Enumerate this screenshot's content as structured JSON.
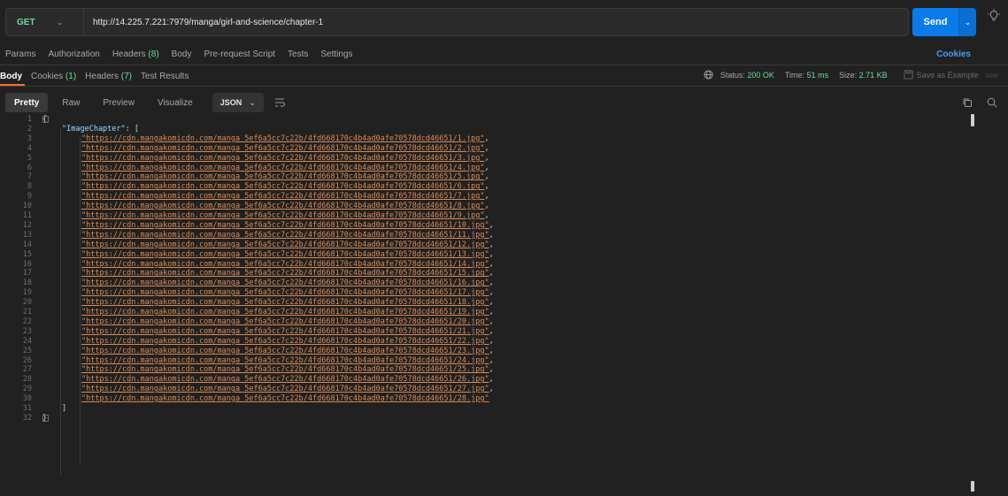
{
  "request": {
    "method": "GET",
    "url": "http://14.225.7.221:7979/manga/girl-and-science/chapter-1",
    "send_label": "Send"
  },
  "request_tabs": {
    "params": "Params",
    "authorization": "Authorization",
    "headers": "Headers",
    "headers_count": "(8)",
    "body": "Body",
    "pre_request": "Pre-request Script",
    "tests": "Tests",
    "settings": "Settings",
    "cookies": "Cookies"
  },
  "response_tabs": {
    "body": "Body",
    "cookies": "Cookies",
    "cookies_count": "(1)",
    "headers": "Headers",
    "headers_count": "(7)",
    "test_results": "Test Results"
  },
  "response_status": {
    "status_label": "Status:",
    "status_value": "200 OK",
    "time_label": "Time:",
    "time_value": "51 ms",
    "size_label": "Size:",
    "size_value": "2.71 KB",
    "save_example": "Save as Example"
  },
  "body_toolbar": {
    "pretty": "Pretty",
    "raw": "Raw",
    "preview": "Preview",
    "visualize": "Visualize",
    "format": "JSON"
  },
  "colors": {
    "accent_send": "#097bed",
    "method_get": "#6bdd9a",
    "tab_underline": "#ff6c37",
    "string": "#d98b55",
    "key": "#9cdcfe"
  },
  "code": {
    "open_brace": "{",
    "key": "\"ImageChapter\"",
    "key_suffix": ": [",
    "urls": [
      "\"https://cdn.mangakomicdn.com/manga_5ef6a5cc7c22b/4fd668170c4b4ad0afe70578dcd46651/1.jpg\"",
      "\"https://cdn.mangakomicdn.com/manga_5ef6a5cc7c22b/4fd668170c4b4ad0afe70578dcd46651/2.jpg\"",
      "\"https://cdn.mangakomicdn.com/manga_5ef6a5cc7c22b/4fd668170c4b4ad0afe70578dcd46651/3.jpg\"",
      "\"https://cdn.mangakomicdn.com/manga_5ef6a5cc7c22b/4fd668170c4b4ad0afe70578dcd46651/4.jpg\"",
      "\"https://cdn.mangakomicdn.com/manga_5ef6a5cc7c22b/4fd668170c4b4ad0afe70578dcd46651/5.jpg\"",
      "\"https://cdn.mangakomicdn.com/manga_5ef6a5cc7c22b/4fd668170c4b4ad0afe70578dcd46651/6.jpg\"",
      "\"https://cdn.mangakomicdn.com/manga_5ef6a5cc7c22b/4fd668170c4b4ad0afe70578dcd46651/7.jpg\"",
      "\"https://cdn.mangakomicdn.com/manga_5ef6a5cc7c22b/4fd668170c4b4ad0afe70578dcd46651/8.jpg\"",
      "\"https://cdn.mangakomicdn.com/manga_5ef6a5cc7c22b/4fd668170c4b4ad0afe70578dcd46651/9.jpg\"",
      "\"https://cdn.mangakomicdn.com/manga_5ef6a5cc7c22b/4fd668170c4b4ad0afe70578dcd46651/10.jpg\"",
      "\"https://cdn.mangakomicdn.com/manga_5ef6a5cc7c22b/4fd668170c4b4ad0afe70578dcd46651/11.jpg\"",
      "\"https://cdn.mangakomicdn.com/manga_5ef6a5cc7c22b/4fd668170c4b4ad0afe70578dcd46651/12.jpg\"",
      "\"https://cdn.mangakomicdn.com/manga_5ef6a5cc7c22b/4fd668170c4b4ad0afe70578dcd46651/13.jpg\"",
      "\"https://cdn.mangakomicdn.com/manga_5ef6a5cc7c22b/4fd668170c4b4ad0afe70578dcd46651/14.jpg\"",
      "\"https://cdn.mangakomicdn.com/manga_5ef6a5cc7c22b/4fd668170c4b4ad0afe70578dcd46651/15.jpg\"",
      "\"https://cdn.mangakomicdn.com/manga_5ef6a5cc7c22b/4fd668170c4b4ad0afe70578dcd46651/16.jpg\"",
      "\"https://cdn.mangakomicdn.com/manga_5ef6a5cc7c22b/4fd668170c4b4ad0afe70578dcd46651/17.jpg\"",
      "\"https://cdn.mangakomicdn.com/manga_5ef6a5cc7c22b/4fd668170c4b4ad0afe70578dcd46651/18.jpg\"",
      "\"https://cdn.mangakomicdn.com/manga_5ef6a5cc7c22b/4fd668170c4b4ad0afe70578dcd46651/19.jpg\"",
      "\"https://cdn.mangakomicdn.com/manga_5ef6a5cc7c22b/4fd668170c4b4ad0afe70578dcd46651/20.jpg\"",
      "\"https://cdn.mangakomicdn.com/manga_5ef6a5cc7c22b/4fd668170c4b4ad0afe70578dcd46651/21.jpg\"",
      "\"https://cdn.mangakomicdn.com/manga_5ef6a5cc7c22b/4fd668170c4b4ad0afe70578dcd46651/22.jpg\"",
      "\"https://cdn.mangakomicdn.com/manga_5ef6a5cc7c22b/4fd668170c4b4ad0afe70578dcd46651/23.jpg\"",
      "\"https://cdn.mangakomicdn.com/manga_5ef6a5cc7c22b/4fd668170c4b4ad0afe70578dcd46651/24.jpg\"",
      "\"https://cdn.mangakomicdn.com/manga_5ef6a5cc7c22b/4fd668170c4b4ad0afe70578dcd46651/25.jpg\"",
      "\"https://cdn.mangakomicdn.com/manga_5ef6a5cc7c22b/4fd668170c4b4ad0afe70578dcd46651/26.jpg\"",
      "\"https://cdn.mangakomicdn.com/manga_5ef6a5cc7c22b/4fd668170c4b4ad0afe70578dcd46651/27.jpg\"",
      "\"https://cdn.mangakomicdn.com/manga_5ef6a5cc7c22b/4fd668170c4b4ad0afe70578dcd46651/28.jpg\""
    ],
    "close_bracket": "]",
    "close_brace": "}"
  }
}
